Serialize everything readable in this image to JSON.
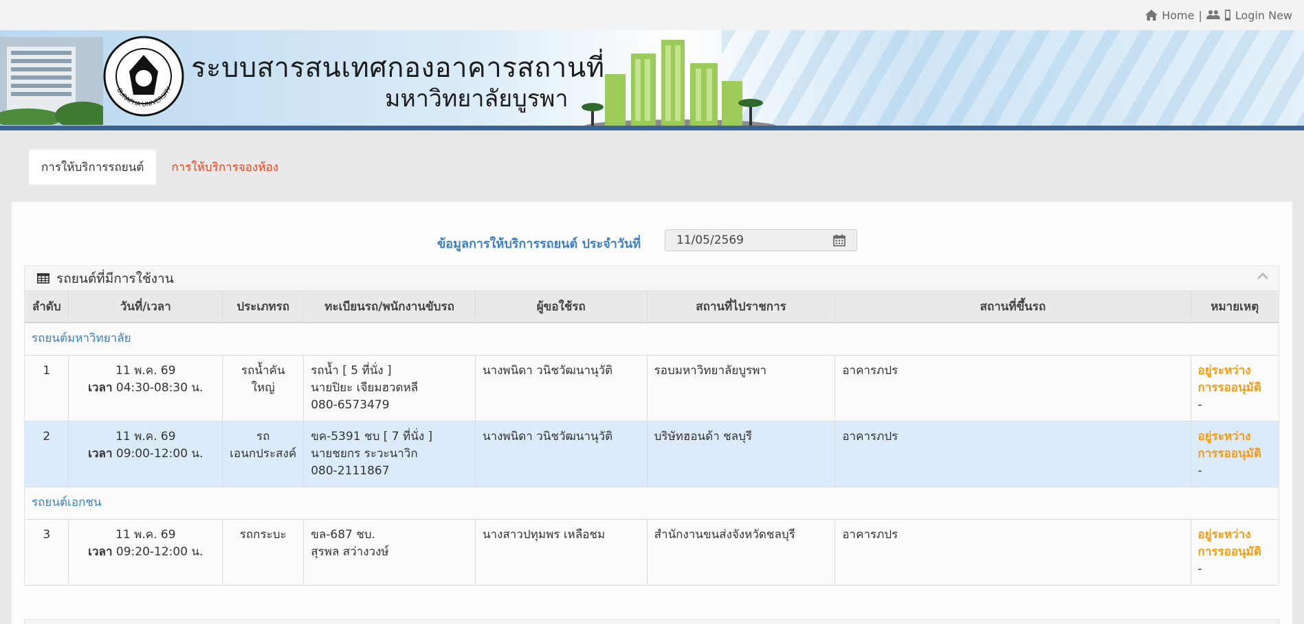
{
  "topbar": {
    "home_label": "Home",
    "separator": "|",
    "login_label": "Login New"
  },
  "banner": {
    "title_line1": "ระบบสารสนเทศกองอาคารสถานที่",
    "title_line2": "มหาวิทยาลัยบูรพา",
    "logo_text": "BURAPHA UNIVERSITY"
  },
  "tabs": [
    {
      "label": "การให้บริการรถยนต์",
      "active": true
    },
    {
      "label": "การให้บริการจองห้อง",
      "active": false
    }
  ],
  "date_filter": {
    "label": "ข้อมูลการให้บริการรถยนต์ ประจำวันที่",
    "value": "11/05/2569"
  },
  "vehicles_box": {
    "title": "รถยนต์ที่มีการใช้งาน",
    "columns": [
      "ลำดับ",
      "วันที่/เวลา",
      "ประเภทรถ",
      "ทะเบียนรถ/พนักงานขับรถ",
      "ผู้ขอใช้รถ",
      "สถานที่ไปราชการ",
      "สถานที่ขึ้นรถ",
      "หมายเหตุ"
    ],
    "groups": [
      {
        "name": "รถยนต์มหาวิทยาลัย",
        "rows": [
          {
            "no": "1",
            "date": "11 พ.ค. 69",
            "time_label": "เวลา",
            "time": "04:30-08:30 น.",
            "type_l1": "รถน้ำคันใหญ่",
            "type_l2": "",
            "plate": "รถน้ำ [ 5 ที่นั่ง ]",
            "driver": "นายปิยะ เจียมฮวดหลี",
            "phone": "080-6573479",
            "requester": "นางพนิดา วนิชวัฒนานุวัติ",
            "destination": "รอบมหาวิทยาลัยบูรพา",
            "pickup": "อาคารภปร",
            "status_l1": "อยู่ระหว่าง",
            "status_l2": "การรออนุมัติ",
            "note": "-"
          },
          {
            "no": "2",
            "date": "11 พ.ค. 69",
            "time_label": "เวลา",
            "time": "09:00-12:00 น.",
            "type_l1": "รถ",
            "type_l2": "เอนกประสงค์",
            "plate": "ขค-5391 ชบ [ 7 ที่นั่ง ]",
            "driver": "นายชยกร ระวะนาวิก",
            "phone": "080-2111867",
            "requester": "นางพนิดา วนิชวัฒนานุวัติ",
            "destination": "บริษัทฮอนด้า ชลบุรี",
            "pickup": "อาคารภปร",
            "status_l1": "อยู่ระหว่าง",
            "status_l2": "การรออนุมัติ",
            "note": "-"
          }
        ]
      },
      {
        "name": "รถยนต์เอกชน",
        "rows": [
          {
            "no": "3",
            "date": "11 พ.ค. 69",
            "time_label": "เวลา",
            "time": "09:20-12:00 น.",
            "type_l1": "รถกระบะ",
            "type_l2": "",
            "plate": "ขล-687 ชบ.",
            "driver": "สุรพล สว่างวงษ์",
            "phone": "",
            "requester": "นางสาวปทุมพร เหลือชม",
            "destination": "สำนักงานขนส่งจังหวัดชลบุรี",
            "pickup": "อาคารภปร",
            "status_l1": "อยู่ระหว่าง",
            "status_l2": "การรออนุมัติ",
            "note": "-"
          }
        ]
      }
    ]
  },
  "colors": {
    "link_blue": "#3b7fc4",
    "tab_link_red": "#e8461a",
    "status_orange": "#f39c12",
    "highlight_row": "#dcebfb",
    "banner_bar": "#3a6492"
  },
  "icons": {
    "home": "home-icon",
    "users": "users-icon",
    "mobile": "mobile-icon",
    "calendar": "calendar-icon",
    "table": "table-icon",
    "collapse": "chevron-up-icon"
  }
}
